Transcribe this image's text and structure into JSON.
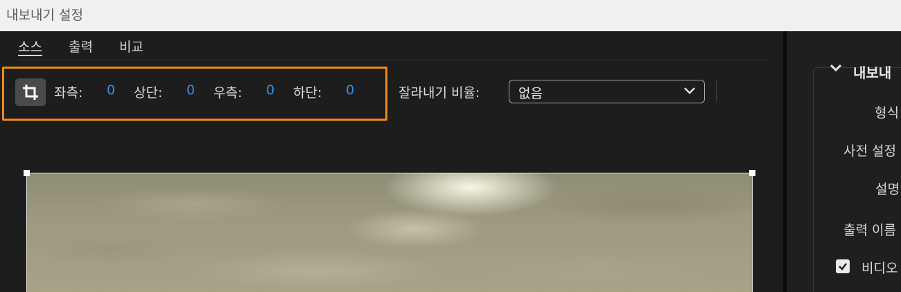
{
  "window": {
    "title": "내보내기 설정"
  },
  "tabs": [
    {
      "label": "소스",
      "active": true
    },
    {
      "label": "출력",
      "active": false
    },
    {
      "label": "비교",
      "active": false
    }
  ],
  "crop": {
    "icon": "crop-icon",
    "left_label": "좌측:",
    "left_value": "0",
    "top_label": "상단:",
    "top_value": "0",
    "right_label": "우측:",
    "right_value": "0",
    "bottom_label": "하단:",
    "bottom_value": "0",
    "highlight_color": "#f08a1b",
    "value_color": "#3d8fe6"
  },
  "aspect": {
    "label": "잘라내기 비율:",
    "value": "없음",
    "icon": "chevron-down-icon"
  },
  "right_panel": {
    "section_title": "내보내",
    "labels": [
      "형식",
      "사전 설정",
      "설명",
      "출력 이름"
    ],
    "checkbox_label": "비디오",
    "checkbox_checked": true
  }
}
